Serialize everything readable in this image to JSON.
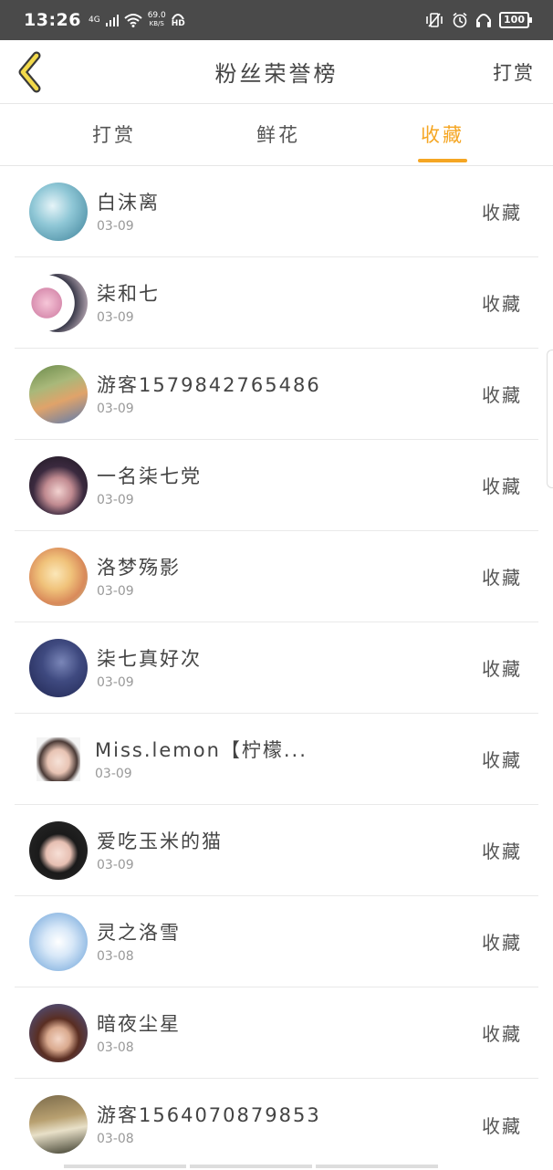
{
  "status": {
    "time": "13:26",
    "network": "4G",
    "speed_top": "69.0",
    "speed_bottom": "KB/S",
    "hd": "HD",
    "battery": "100"
  },
  "header": {
    "title": "粉丝荣誉榜",
    "right_action": "打赏"
  },
  "tabs": [
    {
      "label": "打赏",
      "active": false
    },
    {
      "label": "鲜花",
      "active": false
    },
    {
      "label": "收藏",
      "active": true
    }
  ],
  "colors": {
    "accent": "#f5a623",
    "status_bar": "#4a4a4a"
  },
  "list": [
    {
      "name": "白沫离",
      "date": "03-09",
      "action": "收藏"
    },
    {
      "name": "柒和七",
      "date": "03-09",
      "action": "收藏"
    },
    {
      "name": "游客1579842765486",
      "date": "03-09",
      "action": "收藏"
    },
    {
      "name": "一名柒七党",
      "date": "03-09",
      "action": "收藏"
    },
    {
      "name": "洛梦殇影",
      "date": "03-09",
      "action": "收藏"
    },
    {
      "name": "柒七真好次",
      "date": "03-09",
      "action": "收藏"
    },
    {
      "name": "Miss.lemon【柠檬...",
      "date": "03-09",
      "action": "收藏"
    },
    {
      "name": "爱吃玉米的猫",
      "date": "03-09",
      "action": "收藏"
    },
    {
      "name": "灵之洛雪",
      "date": "03-08",
      "action": "收藏"
    },
    {
      "name": "暗夜尘星",
      "date": "03-08",
      "action": "收藏"
    },
    {
      "name": "游客1564070879853",
      "date": "03-08",
      "action": "收藏"
    }
  ]
}
